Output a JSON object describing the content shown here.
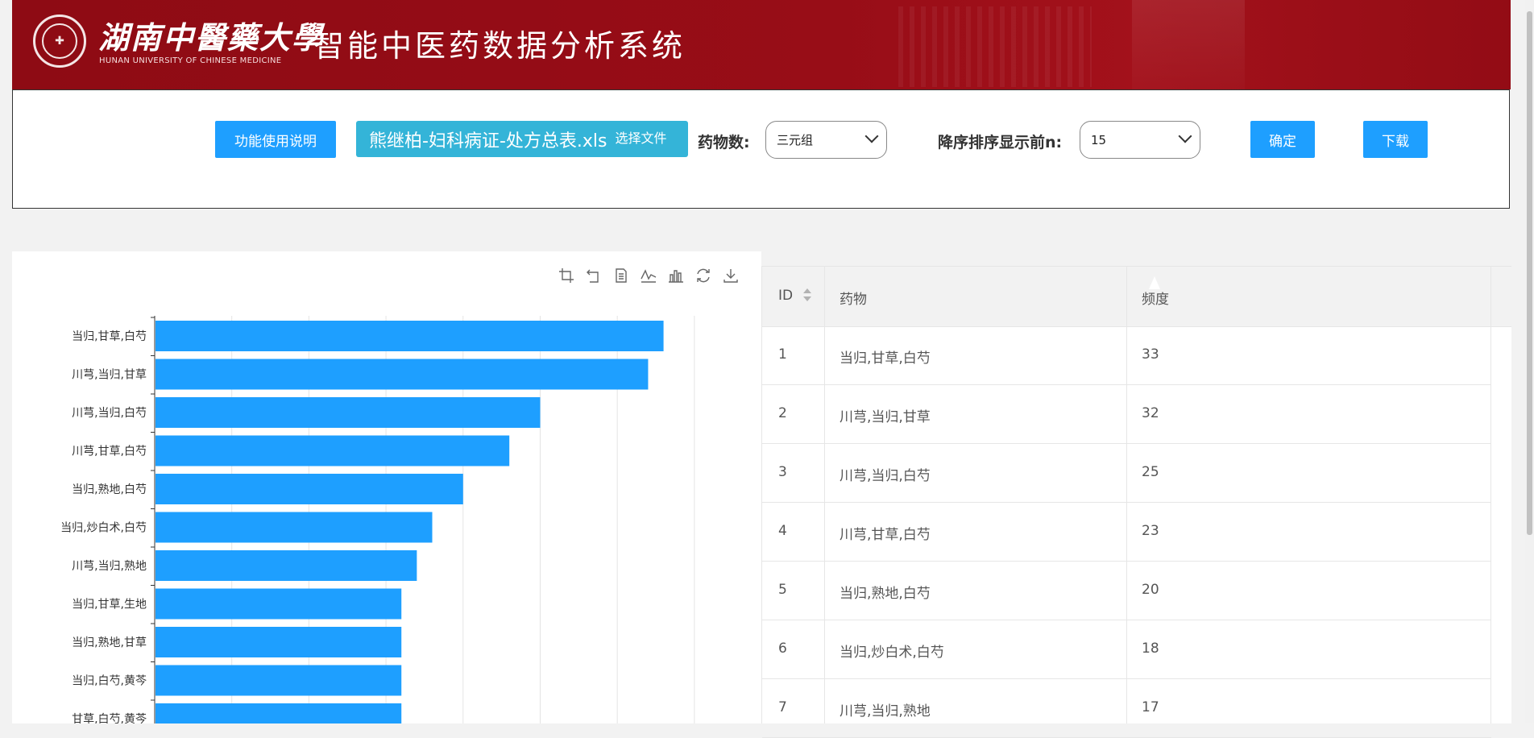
{
  "header": {
    "university_cn": "湖南中醫藥大學",
    "university_en": "HUNAN UNIVERSITY OF CHINESE MEDICINE",
    "system_title": "智能中医药数据分析系统"
  },
  "controls": {
    "help_label": "功能使用说明",
    "file_name": "熊继柏-妇科病证-处方总表.xls",
    "choose_file_label": "选择文件",
    "herb_count_label": "药物数:",
    "herb_count_value": "三元组",
    "topn_label": "降序排序显示前n:",
    "topn_value": "15",
    "confirm_label": "确定",
    "download_label": "下载"
  },
  "toolbox": [
    "crop-icon",
    "undo-zoom-icon",
    "data-view-icon",
    "line-chart-icon",
    "bar-chart-icon",
    "restore-icon",
    "download-icon"
  ],
  "colors": {
    "bar": "#1e9fff",
    "header": "#960c16",
    "accent": "#1e9fff"
  },
  "chart_data": {
    "type": "bar",
    "orientation": "horizontal",
    "categories": [
      "当归,甘草,白芍",
      "川芎,当归,甘草",
      "川芎,当归,白芍",
      "川芎,甘草,白芍",
      "当归,熟地,白芍",
      "当归,炒白术,白芍",
      "川芎,当归,熟地",
      "当归,甘草,生地",
      "当归,熟地,甘草",
      "当归,白芍,黄芩",
      "甘草,白芍,黄芩"
    ],
    "values": [
      33,
      32,
      25,
      23,
      20,
      18,
      17,
      16,
      16,
      16,
      16
    ],
    "xlim": [
      0,
      36
    ]
  },
  "table": {
    "headers": [
      "ID",
      "药物",
      "频度"
    ],
    "rows": [
      [
        "1",
        "当归,甘草,白芍",
        "33"
      ],
      [
        "2",
        "川芎,当归,甘草",
        "32"
      ],
      [
        "3",
        "川芎,当归,白芍",
        "25"
      ],
      [
        "4",
        "川芎,甘草,白芍",
        "23"
      ],
      [
        "5",
        "当归,熟地,白芍",
        "20"
      ],
      [
        "6",
        "当归,炒白术,白芍",
        "18"
      ],
      [
        "7",
        "川芎,当归,熟地",
        "17"
      ]
    ]
  }
}
